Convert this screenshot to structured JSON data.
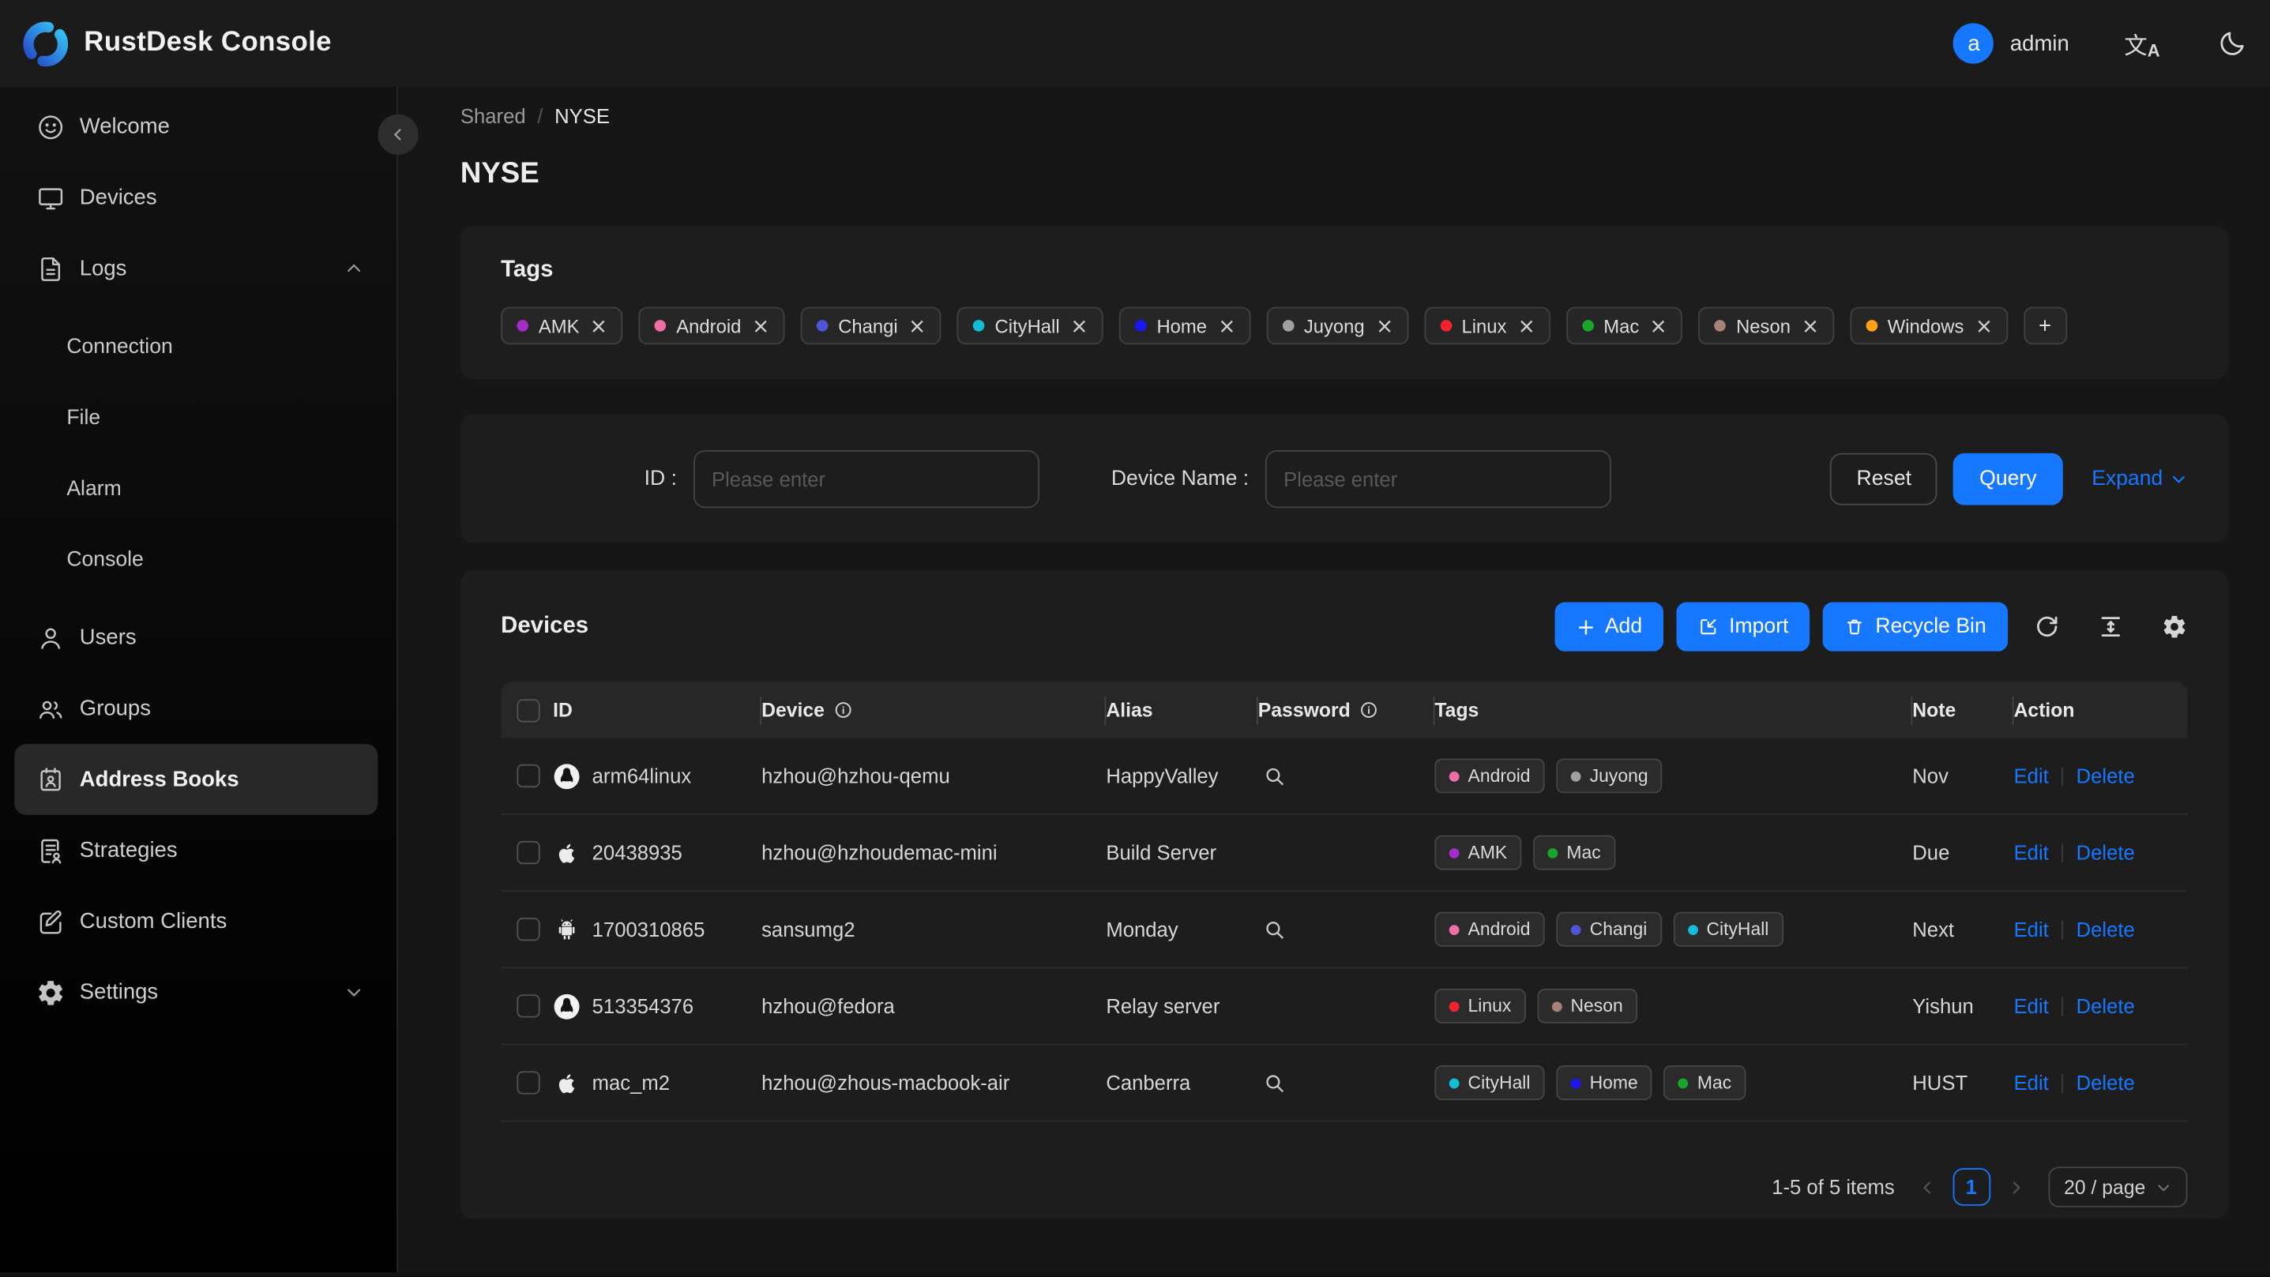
{
  "header": {
    "app_title": "RustDesk Console",
    "user": {
      "avatar_letter": "a",
      "name": "admin"
    }
  },
  "sidebar": {
    "items": [
      {
        "label": "Welcome"
      },
      {
        "label": "Devices"
      },
      {
        "label": "Logs"
      },
      {
        "label": "Connection"
      },
      {
        "label": "File"
      },
      {
        "label": "Alarm"
      },
      {
        "label": "Console"
      },
      {
        "label": "Users"
      },
      {
        "label": "Groups"
      },
      {
        "label": "Address Books"
      },
      {
        "label": "Strategies"
      },
      {
        "label": "Custom Clients"
      },
      {
        "label": "Settings"
      }
    ]
  },
  "breadcrumb": {
    "parent": "Shared",
    "separator": "/",
    "current": "NYSE"
  },
  "page": {
    "title": "NYSE"
  },
  "tags_card": {
    "title": "Tags",
    "add_label": "+",
    "tags": [
      {
        "label": "AMK",
        "color": "#a62cc9"
      },
      {
        "label": "Android",
        "color": "#ef6ea8"
      },
      {
        "label": "Changi",
        "color": "#4d55d4"
      },
      {
        "label": "CityHall",
        "color": "#10bdd4"
      },
      {
        "label": "Home",
        "color": "#1a17f5"
      },
      {
        "label": "Juyong",
        "color": "#9fa0a2"
      },
      {
        "label": "Linux",
        "color": "#f5222d"
      },
      {
        "label": "Mac",
        "color": "#18a52b"
      },
      {
        "label": "Neson",
        "color": "#a88277"
      },
      {
        "label": "Windows",
        "color": "#ffa216"
      }
    ]
  },
  "filter": {
    "id_label": "ID :",
    "id_placeholder": "Please enter",
    "device_label": "Device Name :",
    "device_placeholder": "Please enter",
    "reset_label": "Reset",
    "query_label": "Query",
    "expand_label": "Expand"
  },
  "devices": {
    "title": "Devices",
    "add_label": "Add",
    "import_label": "Import",
    "recycle_label": "Recycle Bin",
    "columns": {
      "id": "ID",
      "device": "Device",
      "alias": "Alias",
      "password": "Password",
      "tags": "Tags",
      "note": "Note",
      "action": "Action"
    },
    "action_labels": {
      "edit": "Edit",
      "delete": "Delete"
    },
    "rows": [
      {
        "os": "linux",
        "id": "arm64linux",
        "device": "hzhou@hzhou-qemu",
        "alias": "HappyValley",
        "has_password": true,
        "note": "Nov",
        "tags": [
          {
            "label": "Android",
            "color": "#ef6ea8"
          },
          {
            "label": "Juyong",
            "color": "#9fa0a2"
          }
        ]
      },
      {
        "os": "mac",
        "id": "20438935",
        "device": "hzhou@hzhoudemac-mini",
        "alias": "Build Server",
        "has_password": false,
        "note": "Due",
        "tags": [
          {
            "label": "AMK",
            "color": "#a62cc9"
          },
          {
            "label": "Mac",
            "color": "#18a52b"
          }
        ]
      },
      {
        "os": "android",
        "id": "1700310865",
        "device": "sansumg2",
        "alias": "Monday",
        "has_password": true,
        "note": "Next",
        "tags": [
          {
            "label": "Android",
            "color": "#ef6ea8"
          },
          {
            "label": "Changi",
            "color": "#4d55d4"
          },
          {
            "label": "CityHall",
            "color": "#10bdd4"
          }
        ]
      },
      {
        "os": "linux",
        "id": "513354376",
        "device": "hzhou@fedora",
        "alias": "Relay server",
        "has_password": false,
        "note": "Yishun",
        "tags": [
          {
            "label": "Linux",
            "color": "#f5222d"
          },
          {
            "label": "Neson",
            "color": "#a88277"
          }
        ]
      },
      {
        "os": "mac",
        "id": "mac_m2",
        "device": "hzhou@zhous-macbook-air",
        "alias": "Canberra",
        "has_password": true,
        "note": "HUST",
        "tags": [
          {
            "label": "CityHall",
            "color": "#10bdd4"
          },
          {
            "label": "Home",
            "color": "#1a17f5"
          },
          {
            "label": "Mac",
            "color": "#18a52b"
          }
        ]
      }
    ],
    "pagination": {
      "summary": "1-5 of 5 items",
      "page": "1",
      "page_size": "20 / page"
    }
  },
  "colors": {
    "accent": "#1677ff"
  }
}
